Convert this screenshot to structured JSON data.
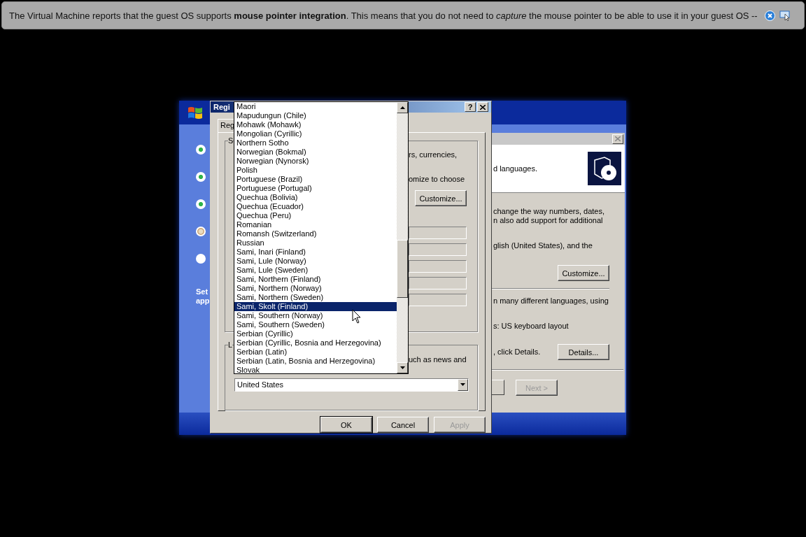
{
  "notification": {
    "text": "The Virtual Machine reports that the guest OS supports **mouse pointer integration**. This means that you do not need to *capture* the mouse pointer to be able to use it in your guest OS --"
  },
  "setup": {
    "steps": [
      {
        "done": true,
        "current": false
      },
      {
        "done": true,
        "current": false
      },
      {
        "done": true,
        "current": false
      },
      {
        "done": false,
        "current": true
      },
      {
        "done": false,
        "current": false
      }
    ],
    "side_text": [
      "Set",
      "app"
    ],
    "header_text": "d languages.",
    "paragraphs": [
      {
        "kind": "text",
        "lines": [
          "change the way numbers, dates,",
          "n also add support for additional"
        ]
      },
      {
        "kind": "text",
        "lines": [
          "glish (United States), and the"
        ]
      },
      {
        "kind": "button",
        "label": "Customize..."
      },
      {
        "kind": "rule"
      },
      {
        "kind": "text",
        "lines": [
          "n many different languages, using"
        ]
      },
      {
        "kind": "text",
        "lines": [
          "s: US keyboard layout"
        ]
      },
      {
        "kind": "row",
        "lines": [
          ", click Details."
        ],
        "label": "Details..."
      }
    ],
    "next": {
      "label": "Next >",
      "disabled": true
    }
  },
  "regional": {
    "title": "Regi",
    "help": "?",
    "tab": "Reg",
    "group1": {
      "label": "S",
      "lines": [
        "rs, currencies,",
        "omize to choose"
      ],
      "button": "Customize..."
    },
    "group2": {
      "label": "L",
      "line": "uch as news and",
      "location": "United States"
    },
    "buttons": [
      {
        "label": "OK",
        "disabled": false
      },
      {
        "label": "Cancel",
        "disabled": false
      },
      {
        "label": "Apply",
        "disabled": true
      }
    ]
  },
  "dropdown": {
    "items": [
      {
        "label": "Maori",
        "selected": false
      },
      {
        "label": "Mapudungun (Chile)",
        "selected": false
      },
      {
        "label": "Mohawk (Mohawk)",
        "selected": false
      },
      {
        "label": "Mongolian (Cyrillic)",
        "selected": false
      },
      {
        "label": "Northern Sotho",
        "selected": false
      },
      {
        "label": "Norwegian (Bokmal)",
        "selected": false
      },
      {
        "label": "Norwegian (Nynorsk)",
        "selected": false
      },
      {
        "label": "Polish",
        "selected": false
      },
      {
        "label": "Portuguese (Brazil)",
        "selected": false
      },
      {
        "label": "Portuguese (Portugal)",
        "selected": false
      },
      {
        "label": "Quechua (Bolivia)",
        "selected": false
      },
      {
        "label": "Quechua (Ecuador)",
        "selected": false
      },
      {
        "label": "Quechua (Peru)",
        "selected": false
      },
      {
        "label": "Romanian",
        "selected": false
      },
      {
        "label": "Romansh (Switzerland)",
        "selected": false
      },
      {
        "label": "Russian",
        "selected": false
      },
      {
        "label": "Sami, Inari (Finland)",
        "selected": false
      },
      {
        "label": "Sami, Lule (Norway)",
        "selected": false
      },
      {
        "label": "Sami, Lule (Sweden)",
        "selected": false
      },
      {
        "label": "Sami, Northern (Finland)",
        "selected": false
      },
      {
        "label": "Sami, Northern (Norway)",
        "selected": false
      },
      {
        "label": "Sami, Northern (Sweden)",
        "selected": false
      },
      {
        "label": "Sami, Skolt (Finland)",
        "selected": true
      },
      {
        "label": "Sami, Southern (Norway)",
        "selected": false
      },
      {
        "label": "Sami, Southern (Sweden)",
        "selected": false
      },
      {
        "label": "Serbian (Cyrillic)",
        "selected": false
      },
      {
        "label": "Serbian (Cyrillic, Bosnia and Herzegovina)",
        "selected": false
      },
      {
        "label": "Serbian (Latin)",
        "selected": false
      },
      {
        "label": "Serbian (Latin, Bosnia and Herzegovina)",
        "selected": false
      },
      {
        "label": "Slovak",
        "selected": false
      }
    ]
  }
}
